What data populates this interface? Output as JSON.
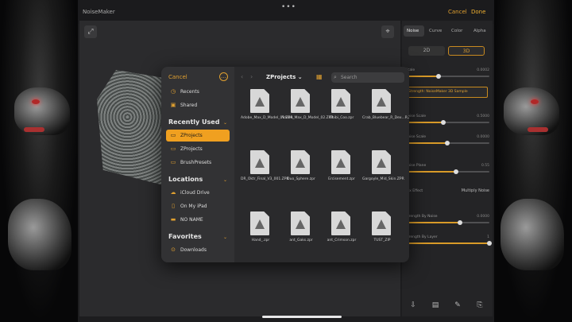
{
  "app": {
    "title": "NoiseMaker",
    "top_cancel": "Cancel",
    "top_done": "Done",
    "more_dots": "•••"
  },
  "panel": {
    "tabs": [
      "Noise",
      "Curve",
      "Color",
      "Alpha"
    ],
    "segments": [
      "2D",
      "3D"
    ],
    "highlight_text": "Strength: NoiseMaker 3D Sample",
    "rows": [
      {
        "label": "Scale",
        "value": "0.0002",
        "fill": 0.4
      },
      {
        "label": "Noise Scale",
        "value": "0.5000",
        "fill": 0.45
      },
      {
        "label": "Noise Scale",
        "value": "0.0000",
        "fill": 0.5
      },
      {
        "label": "Noise Plane",
        "value": "0.55",
        "fill": 0.6
      },
      {
        "label": "Mix Effect",
        "value": "Multiply Noise",
        "fill": null
      },
      {
        "label": "Strength By Noise",
        "value": "0.0000",
        "fill": 0.65
      },
      {
        "label": "Strength By Layer",
        "value": "1",
        "fill": 1.0
      }
    ],
    "bottom_icons": [
      "load-icon",
      "save-icon",
      "brush-icon",
      "export-icon"
    ]
  },
  "picker": {
    "cancel": "Cancel",
    "more_symbol": "…",
    "sections": {
      "recently_used": "Recently Used",
      "locations": "Locations",
      "favorites": "Favorites"
    },
    "top_items": [
      {
        "label": "Recents",
        "icon": "clock-icon"
      },
      {
        "label": "Shared",
        "icon": "shared-folder-icon"
      }
    ],
    "recent_items": [
      {
        "label": "ZProjects",
        "icon": "folder-icon",
        "active": true
      },
      {
        "label": "ZProjects",
        "icon": "folder-icon",
        "active": false
      },
      {
        "label": "BrushPresets",
        "icon": "folder-icon",
        "active": false
      }
    ],
    "location_items": [
      {
        "label": "iCloud Drive",
        "icon": "cloud-icon"
      },
      {
        "label": "On My iPad",
        "icon": "ipad-icon"
      },
      {
        "label": "NO NAME",
        "icon": "drive-icon"
      }
    ],
    "favorite_items": [
      {
        "label": "Downloads",
        "icon": "download-icon"
      }
    ],
    "folder_title": "ZProjects",
    "search_placeholder": "Search",
    "files": [
      {
        "name": "Adobe_Max_D_Model_01.ZPR",
        "meta": ""
      },
      {
        "name": "Adobe_Max_D_Model_02.ZPR",
        "meta": ""
      },
      {
        "name": "Chibi_Coo.zpr",
        "meta": ""
      },
      {
        "name": "Crab_Bluebear_R_Dex...R.ZPR",
        "meta": ""
      },
      {
        "name": "DR_Oktr_Final_V3_001.ZPR",
        "meta": ""
      },
      {
        "name": "Duo_Sphere.zpr",
        "meta": ""
      },
      {
        "name": "Ercisement.zpr",
        "meta": ""
      },
      {
        "name": "Gargoyle_Mid_Skin.ZPR",
        "meta": ""
      },
      {
        "name": "Hand_.zpr",
        "meta": ""
      },
      {
        "name": "ant_Gaks.zpr",
        "meta": ""
      },
      {
        "name": "ant_Crimson.zpr",
        "meta": ""
      },
      {
        "name": "TUST_ZIP",
        "meta": ""
      }
    ]
  },
  "colors": {
    "accent": "#f0a020",
    "panel_bg": "#2a2a2c"
  }
}
